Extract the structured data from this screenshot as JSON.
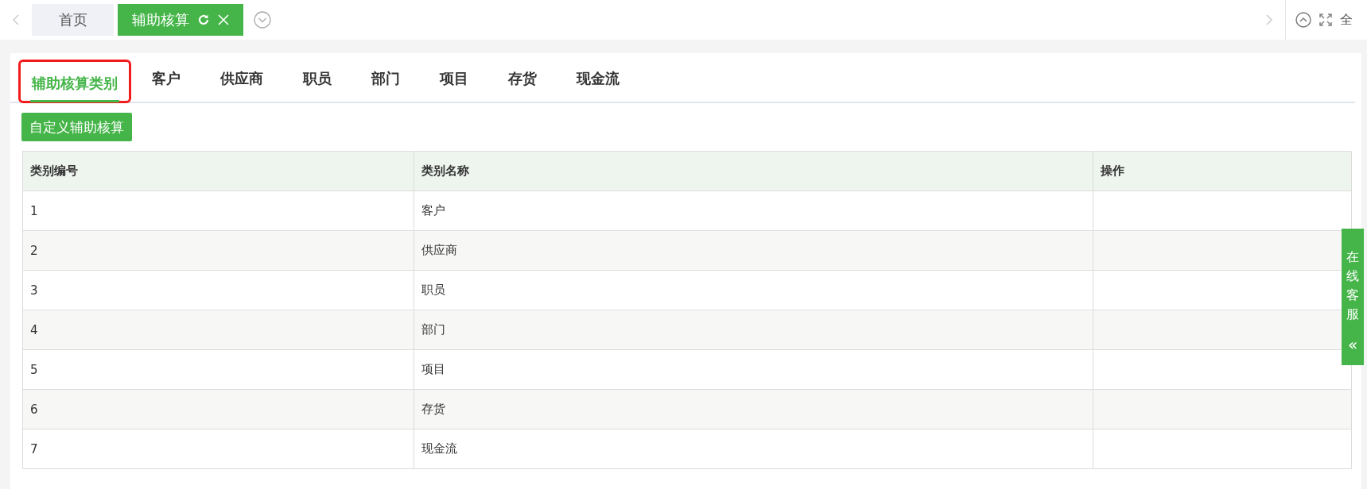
{
  "page_tabs": [
    {
      "label": "首页",
      "selected": false,
      "closable": false
    },
    {
      "label": "辅助核算",
      "selected": true,
      "closable": true
    }
  ],
  "top_right": {
    "fullscreen_label": "全"
  },
  "section_tabs": [
    {
      "label": "辅助核算类别",
      "selected": true,
      "highlighted": true
    },
    {
      "label": "客户",
      "selected": false,
      "highlighted": false
    },
    {
      "label": "供应商",
      "selected": false,
      "highlighted": false
    },
    {
      "label": "职员",
      "selected": false,
      "highlighted": false
    },
    {
      "label": "部门",
      "selected": false,
      "highlighted": false
    },
    {
      "label": "项目",
      "selected": false,
      "highlighted": false
    },
    {
      "label": "存货",
      "selected": false,
      "highlighted": false
    },
    {
      "label": "现金流",
      "selected": false,
      "highlighted": false
    }
  ],
  "custom_button": "自定义辅助核算",
  "table": {
    "columns": [
      "类别编号",
      "类别名称",
      "操作"
    ],
    "rows": [
      [
        "1",
        "客户",
        ""
      ],
      [
        "2",
        "供应商",
        ""
      ],
      [
        "3",
        "职员",
        ""
      ],
      [
        "4",
        "部门",
        ""
      ],
      [
        "5",
        "项目",
        ""
      ],
      [
        "6",
        "存货",
        ""
      ],
      [
        "7",
        "现金流",
        ""
      ]
    ]
  },
  "support_tab": {
    "label": "在线客服",
    "chevron": "«"
  }
}
